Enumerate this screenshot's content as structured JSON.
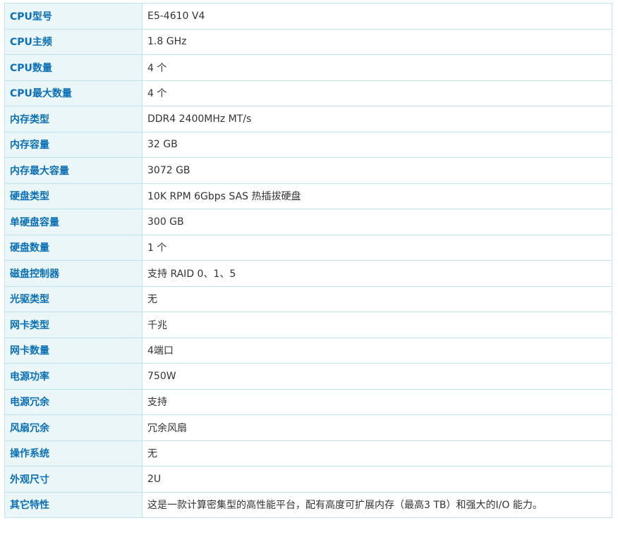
{
  "specs": [
    {
      "label": "CPU型号",
      "value": "E5-4610 V4"
    },
    {
      "label": "CPU主频",
      "value": "1.8  GHz"
    },
    {
      "label": "CPU数量",
      "value": "4  个"
    },
    {
      "label": "CPU最大数量",
      "value": "4  个"
    },
    {
      "label": "内存类型",
      "value": "DDR4 2400MHz MT/s"
    },
    {
      "label": "内存容量",
      "value": "32  GB"
    },
    {
      "label": "内存最大容量",
      "value": "3072  GB"
    },
    {
      "label": "硬盘类型",
      "value": "10K RPM 6Gbps SAS 热插拔硬盘"
    },
    {
      "label": "单硬盘容量",
      "value": "300  GB"
    },
    {
      "label": "硬盘数量",
      "value": "1  个"
    },
    {
      "label": "磁盘控制器",
      "value": "支持 RAID 0、1、5"
    },
    {
      "label": "光驱类型",
      "value": "无"
    },
    {
      "label": "网卡类型",
      "value": "千兆"
    },
    {
      "label": "网卡数量",
      "value": "4端口"
    },
    {
      "label": "电源功率",
      "value": "750W"
    },
    {
      "label": "电源冗余",
      "value": "支持"
    },
    {
      "label": "风扇冗余",
      "value": "冗余风扇"
    },
    {
      "label": "操作系统",
      "value": "无"
    },
    {
      "label": "外观尺寸",
      "value": "2U"
    },
    {
      "label": "其它特性",
      "value": "这是一款计算密集型的高性能平台，配有高度可扩展内存（最高3 TB）和强大的I/O 能力。"
    }
  ]
}
